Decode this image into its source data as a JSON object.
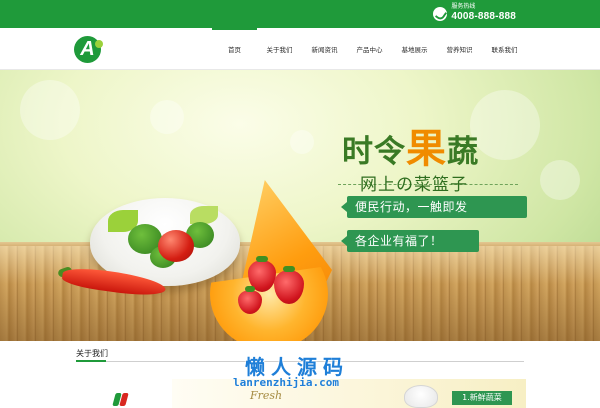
{
  "topbar": {
    "hotline_label": "服务热线",
    "hotline_number": "4008-888-888",
    "icon": "phone-icon"
  },
  "header": {
    "logo_letter": "A",
    "nav": [
      {
        "label": "首页",
        "active": true
      },
      {
        "label": "关于我们",
        "active": false
      },
      {
        "label": "新闻资讯",
        "active": false
      },
      {
        "label": "产品中心",
        "active": false
      },
      {
        "label": "基地展示",
        "active": false
      },
      {
        "label": "营养知识",
        "active": false
      },
      {
        "label": "联系我们",
        "active": false
      }
    ]
  },
  "banner": {
    "slogan_before": "时令",
    "slogan_accent": "果",
    "slogan_after": "蔬",
    "subslogan": "网上の菜篮子",
    "tags": [
      "便民行动，一触即发",
      "各企业有福了！"
    ]
  },
  "about": {
    "title": "关于我们",
    "image_script": "Fresh",
    "image_label": "1.新鲜蔬菜"
  },
  "watermark": {
    "title": "懒人源码",
    "url": "lanrenzhijia.com"
  },
  "colors": {
    "brand_green": "#1f9a3a",
    "tag_green": "#2e9651",
    "accent_orange": "#f08b00",
    "watermark_blue": "#1f7fd8"
  }
}
